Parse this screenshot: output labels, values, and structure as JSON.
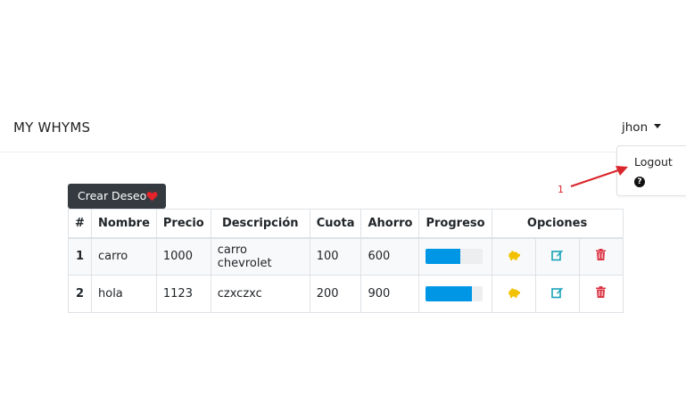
{
  "navbar": {
    "brand": "MY WHYMS",
    "user": "jhon"
  },
  "dropdown": {
    "logout": "Logout",
    "help_glyph": "?"
  },
  "annotation": {
    "number": "1",
    "color": "#d9262c"
  },
  "create_button": {
    "label": "Crear Deseo",
    "icon": "heart-icon",
    "icon_color": "#e3242b"
  },
  "table": {
    "headers": [
      "#",
      "Nombre",
      "Precio",
      "Descripción",
      "Cuota",
      "Ahorro",
      "Progreso",
      "Opciones"
    ],
    "rows": [
      {
        "num": "1",
        "nombre": "carro",
        "precio": "1000",
        "descripcion": "carro chevrolet",
        "cuota": "100",
        "ahorro": "600",
        "progress": 0.6
      },
      {
        "num": "2",
        "nombre": "hola",
        "precio": "1123",
        "descripcion": "czxczxc",
        "cuota": "200",
        "ahorro": "900",
        "progress": 0.8
      }
    ],
    "option_icons": [
      "piggy-bank-icon",
      "edit-icon",
      "trash-icon"
    ]
  },
  "colors": {
    "progress": "#0096e6",
    "piggy": "#f2c200",
    "edit": "#17a2b8",
    "delete": "#dc3545",
    "navbar_dark": "#343a40"
  }
}
